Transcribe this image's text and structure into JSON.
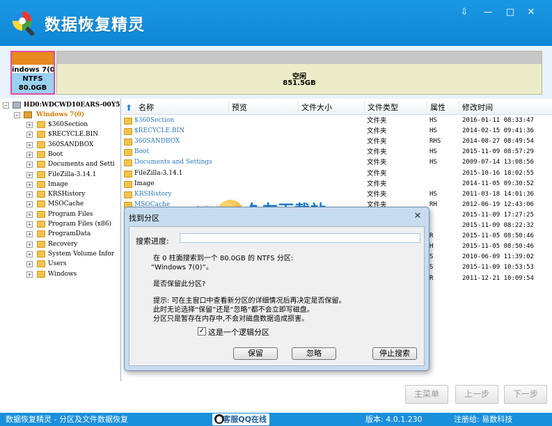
{
  "app": {
    "title": "数据恢复精灵"
  },
  "window_controls": {
    "restore": "⇩",
    "minimize": "—",
    "maximize": "□",
    "close": "✕"
  },
  "partitions": [
    {
      "name": "indows 7(0",
      "fs": "NTFS",
      "size": "80.0GB",
      "selected": true,
      "used_fraction": 0.7
    },
    {
      "name": "空闲",
      "size": "851.5GB"
    }
  ],
  "tree": {
    "disk": "HD0:WDCWD10EARS-00Y5B1",
    "partition": "Windows 7(0)",
    "items": [
      "$360Section",
      "$RECYCLE.BIN",
      "360SANDBOX",
      "Boot",
      "Documents and Setti",
      "FileZilla-3.14.1",
      "Image",
      "KRSHistory",
      "MSOCache",
      "Program Files",
      "Program Files (x86)",
      "ProgramData",
      "Recovery",
      "System Volume Infor",
      "Users",
      "Windows"
    ]
  },
  "list": {
    "headers": {
      "name": "名称",
      "preview": "预览",
      "size": "文件大小",
      "type": "文件类型",
      "attr": "属性",
      "modified": "修改时间"
    },
    "rows": [
      {
        "name": "$360Section",
        "type": "文件夹",
        "attr": "HS",
        "modified": "2016-01-11 08:33:47",
        "blue": true
      },
      {
        "name": "$RECYCLE.BIN",
        "type": "文件夹",
        "attr": "HS",
        "modified": "2014-02-15 09:41:36",
        "blue": true
      },
      {
        "name": "360SANDBOX",
        "type": "文件夹",
        "attr": "RHS",
        "modified": "2014-08-27 08:49:54",
        "blue": true
      },
      {
        "name": "Boot",
        "type": "文件夹",
        "attr": "HS",
        "modified": "2015-11-09 08:57:29",
        "blue": true
      },
      {
        "name": "Documents and Settings",
        "type": "文件夹",
        "attr": "HS",
        "modified": "2009-07-14 13:08:56",
        "blue": true
      },
      {
        "name": "FileZilla-3.14.1",
        "type": "文件夹",
        "attr": "",
        "modified": "2015-10-16 18:02:55",
        "blue": false
      },
      {
        "name": "Image",
        "type": "文件夹",
        "attr": "",
        "modified": "2014-11-05 09:30:52",
        "blue": false
      },
      {
        "name": "KRSHistory",
        "type": "文件夹",
        "attr": "HS",
        "modified": "2011-03-18 14:01:36",
        "blue": true
      },
      {
        "name": "MSOCache",
        "type": "文件夹",
        "attr": "RH",
        "modified": "2012-06-19 12:43:06",
        "blue": true
      },
      {
        "name": "",
        "type": "",
        "attr": "",
        "modified": "2015-11-09 17:27:25",
        "blue": false
      },
      {
        "name": "",
        "type": "",
        "attr": "",
        "modified": "2015-11-09 08:22:32",
        "blue": false
      },
      {
        "name": "",
        "type": "",
        "attr": "R",
        "modified": "2015-11-05 08:50:46",
        "blue": false
      },
      {
        "name": "",
        "type": "",
        "attr": "H",
        "modified": "2015-11-05 08:50:46",
        "blue": false
      },
      {
        "name": "",
        "type": "",
        "attr": "S",
        "modified": "2010-06-09 11:39:02",
        "blue": false
      },
      {
        "name": "",
        "type": "",
        "attr": "S",
        "modified": "2015-11-09 10:53:53",
        "blue": false
      },
      {
        "name": "",
        "type": "",
        "attr": "R",
        "modified": "2011-12-21 10:09:54",
        "blue": false
      }
    ]
  },
  "watermark": {
    "brand": "久友下载站",
    "url": "www.9UPK.com",
    "faint": "www.9UPK.COM"
  },
  "dialog": {
    "title": "找到分区",
    "close": "✕",
    "progress_label": "搜索进度:",
    "line1": "在 0 柱面搜索到一个 80.0GB 的 NTFS 分区:",
    "line2": "“Windows 7(0)”。",
    "question": "是否保留此分区?",
    "hint1": "提示: 可在主窗口中查看新分区的详细情况后再决定是否保留。",
    "hint2": "此时无论选择“保留”还是“忽略”都不会立即写磁盘。",
    "hint3": "分区只是暂存在内存中,不会对磁盘数据造成损害。",
    "checkbox_label": "这是一个逻辑分区",
    "checkbox_mark": "✓",
    "checked": true,
    "buttons": {
      "keep": "保留",
      "ignore": "忽略",
      "stop": "停止搜索"
    }
  },
  "nav_buttons": {
    "main_menu": "主菜单",
    "prev": "上一步",
    "next": "下一步"
  },
  "statusbar": {
    "app_desc": "数据恢复精灵 - 分区及文件数据恢复",
    "qq": "客服QQ在线",
    "version": "版本: 4.0.1.230",
    "registered": "注册给: 易数科技"
  },
  "colors": {
    "titlebar": "#1b98e3",
    "accent_pink": "#e64aa0",
    "folder": "#f3c44c",
    "link_blue": "#2b7ac3"
  }
}
